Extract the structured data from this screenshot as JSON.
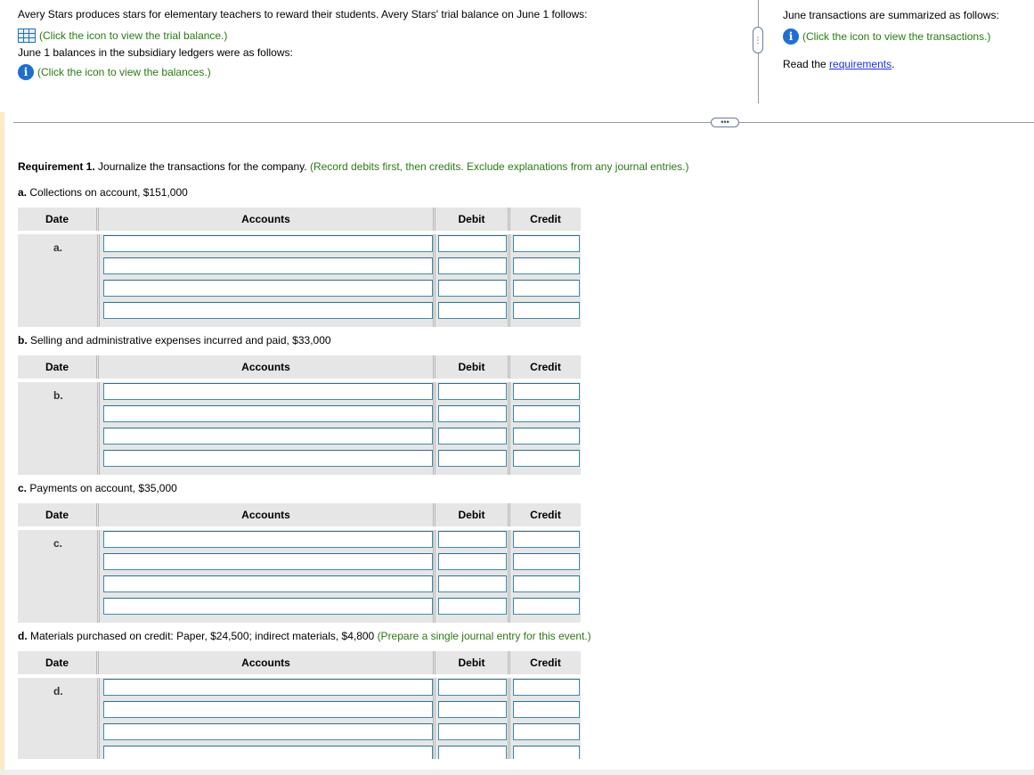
{
  "intro": {
    "line1": "Avery Stars produces stars for elementary teachers to reward their students. Avery Stars' trial balance on June 1 follows:",
    "trial_balance_link": "(Click the icon to view the trial balance.)",
    "line2": "June 1 balances in the subsidiary ledgers were as follows:",
    "balances_link": "(Click the icon to view the balances.)"
  },
  "side": {
    "line1": "June transactions are summarized as follows:",
    "transactions_link": "(Click the icon to view the transactions.)",
    "read_prefix": "Read the ",
    "requirements_link": "requirements",
    "read_suffix": "."
  },
  "requirement": {
    "bold": "Requirement 1.",
    "text": " Journalize the transactions for the company. ",
    "note": "(Record debits first, then credits. Exclude explanations from any journal entries.)"
  },
  "columns": {
    "date": "Date",
    "accounts": "Accounts",
    "debit": "Debit",
    "credit": "Credit"
  },
  "transactions": [
    {
      "letter": "a.",
      "title": " Collections on account, $151,000",
      "note": "",
      "row_label": "a."
    },
    {
      "letter": "b.",
      "title": " Selling and administrative expenses incurred and paid, $33,000",
      "note": "",
      "row_label": "b."
    },
    {
      "letter": "c.",
      "title": " Payments on account, $35,000",
      "note": "",
      "row_label": "c."
    },
    {
      "letter": "d.",
      "title": " Materials purchased on credit: Paper, $24,500; indirect materials, $4,800 ",
      "note": "(Prepare a single journal entry for this event.)",
      "row_label": "d."
    }
  ],
  "colors": {
    "accent_green": "#2a7a12",
    "link_blue": "#1b2ff2",
    "info_blue": "#1f6fd1",
    "input_border": "#3b8cae"
  }
}
